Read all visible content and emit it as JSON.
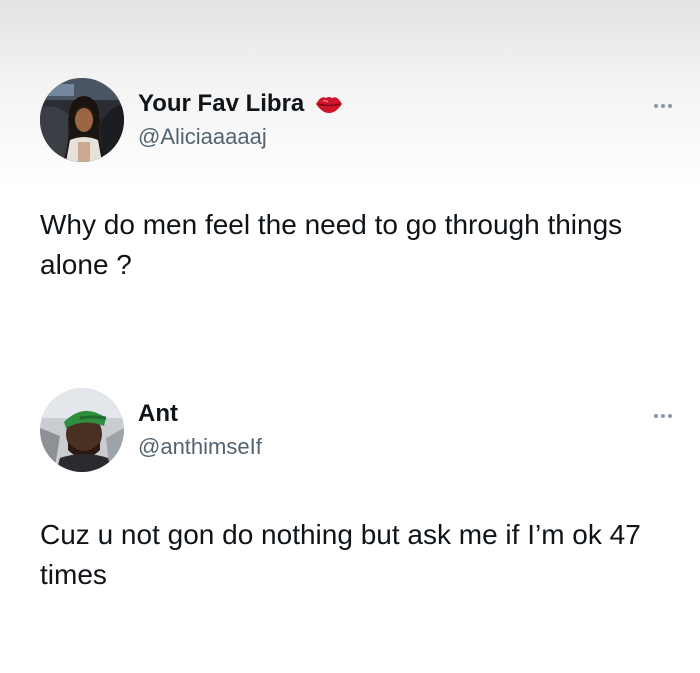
{
  "tweets": [
    {
      "display_name": "Your Fav Libra",
      "badge_icon": "kiss-lips-icon",
      "handle": "@Aliciaaaaaj",
      "text": "Why do men feel the need to go through things alone ?",
      "avatar_icon": "profile-photo"
    },
    {
      "display_name": "Ant",
      "handle": "@anthimseIf",
      "text": "Cuz u not gon do nothing but ask me if I’m ok 47 times",
      "avatar_icon": "profile-photo"
    }
  ],
  "icons": {
    "more": "more-options-icon"
  },
  "colors": {
    "text_primary": "#0f1419",
    "text_secondary": "#536471",
    "lips": "#d0142a"
  }
}
